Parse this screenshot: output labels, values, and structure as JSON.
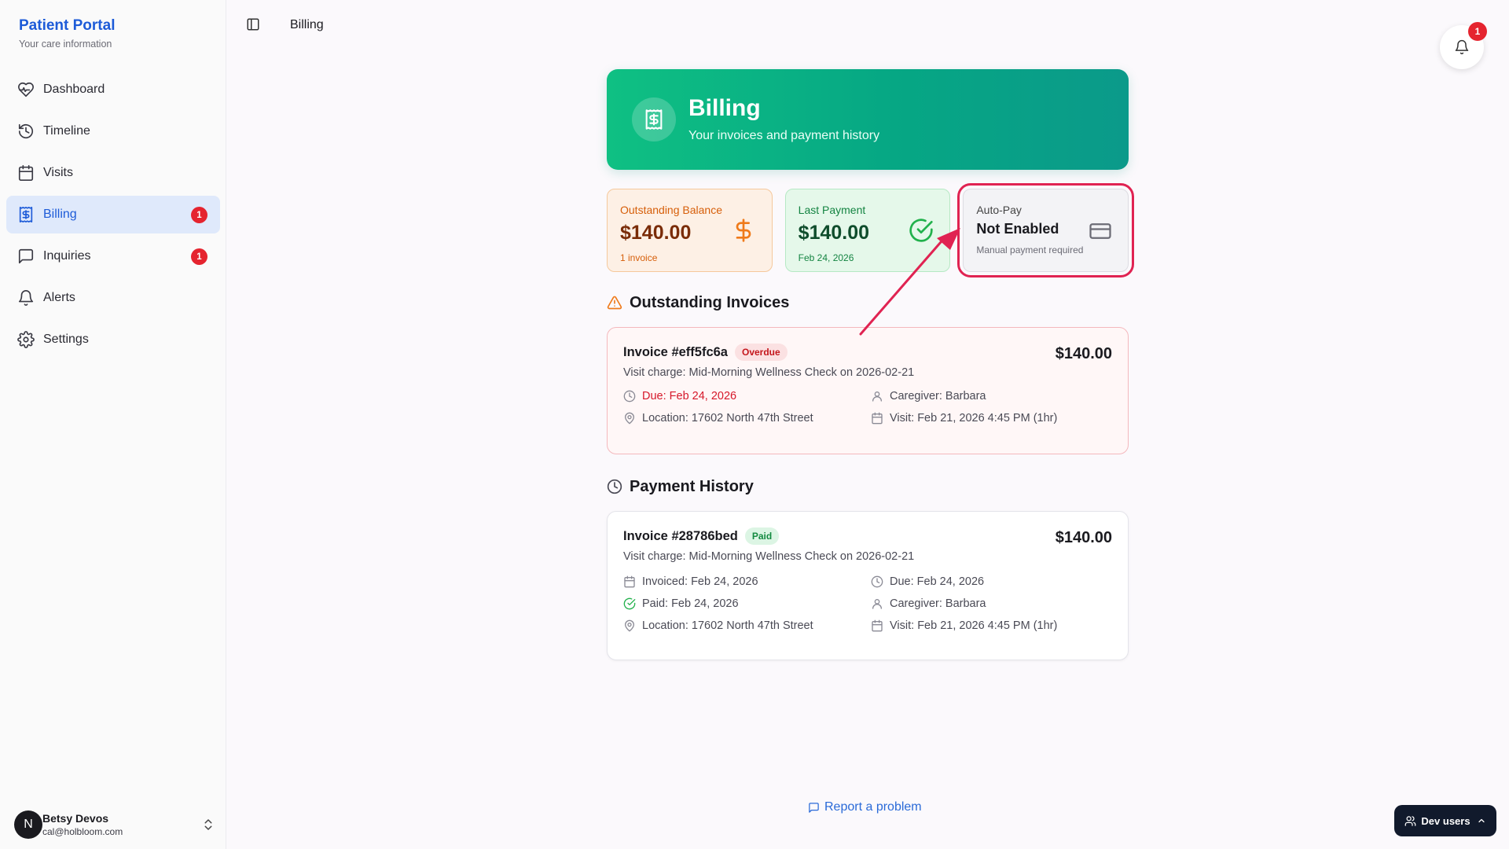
{
  "brand": {
    "title": "Patient Portal",
    "subtitle": "Your care information"
  },
  "sidebar": {
    "items": [
      {
        "label": "Dashboard",
        "icon": "heart-pulse-icon"
      },
      {
        "label": "Timeline",
        "icon": "history-icon"
      },
      {
        "label": "Visits",
        "icon": "calendar-icon"
      },
      {
        "label": "Billing",
        "icon": "receipt-dollar-icon",
        "active": true,
        "badge": "1"
      },
      {
        "label": "Inquiries",
        "icon": "message-square-icon",
        "badge": "1"
      },
      {
        "label": "Alerts",
        "icon": "bell-icon"
      },
      {
        "label": "Settings",
        "icon": "gear-icon"
      }
    ]
  },
  "user": {
    "initial": "N",
    "name": "Betsy Devos",
    "email": "cal@holbloom.com"
  },
  "header": {
    "breadcrumb": "Billing",
    "notification_count": "1"
  },
  "hero": {
    "title": "Billing",
    "subtitle": "Your invoices and payment history"
  },
  "stats": {
    "outstanding": {
      "label": "Outstanding Balance",
      "value": "$140.00",
      "note": "1 invoice"
    },
    "last_payment": {
      "label": "Last Payment",
      "value": "$140.00",
      "note": "Feb 24, 2026"
    },
    "autopay": {
      "label": "Auto-Pay",
      "value": "Not Enabled",
      "note": "Manual payment required"
    }
  },
  "outstanding_section": {
    "title": "Outstanding Invoices",
    "invoice": {
      "number": "Invoice #eff5fc6a",
      "status": "Overdue",
      "amount": "$140.00",
      "description": "Visit charge: Mid-Morning Wellness Check on 2026-02-21",
      "due": "Due: Feb 24, 2026",
      "caregiver": "Caregiver: Barbara",
      "location": "Location: 17602 North 47th Street",
      "visit": "Visit: Feb 21, 2026 4:45 PM (1hr)"
    }
  },
  "history_section": {
    "title": "Payment History",
    "invoice": {
      "number": "Invoice #28786bed",
      "status": "Paid",
      "amount": "$140.00",
      "description": "Visit charge: Mid-Morning Wellness Check on 2026-02-21",
      "invoiced": "Invoiced: Feb 24, 2026",
      "due": "Due: Feb 24, 2026",
      "paid": "Paid: Feb 24, 2026",
      "caregiver": "Caregiver: Barbara",
      "location": "Location: 17602 North 47th Street",
      "visit": "Visit: Feb 21, 2026 4:45 PM (1hr)"
    }
  },
  "footer": {
    "report_link": "Report a problem",
    "dev_button": "Dev users"
  },
  "colors": {
    "accent": "#1d5bd8",
    "hero_start": "#0fc083",
    "hero_end": "#0b9a8a",
    "danger": "#e5242f",
    "annotation": "#e02352"
  }
}
